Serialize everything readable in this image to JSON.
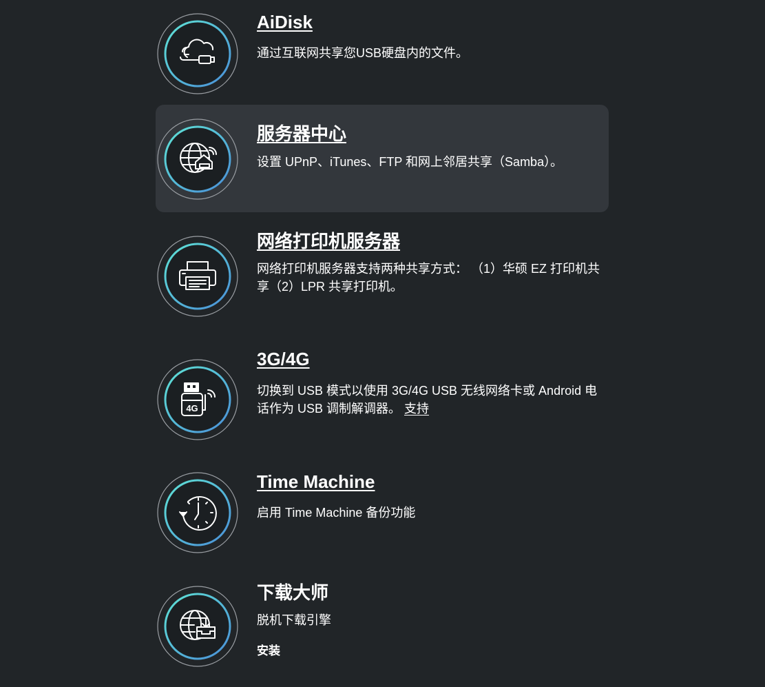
{
  "items": [
    {
      "title": "AiDisk",
      "desc": "通过互联网共享您USB硬盘内的文件。",
      "icon": "cloud-usb-icon"
    },
    {
      "title": "服务器中心",
      "desc": "设置 UPnP、iTunes、FTP 和网上邻居共享（Samba）。",
      "icon": "globe-home-server-icon"
    },
    {
      "title": "网络打印机服务器",
      "desc": "网络打印机服务器支持两种共享方式： （1）华硕 EZ 打印机共享（2）LPR 共享打印机。",
      "icon": "printer-icon"
    },
    {
      "title": "3G/4G",
      "desc": "切换到 USB 模式以使用 3G/4G USB 无线网络卡或 Android 电话作为 USB 调制解调器。",
      "link": "支持",
      "icon": "usb-4g-modem-icon",
      "badge": "4G"
    },
    {
      "title": "Time Machine",
      "desc": "启用 Time Machine 备份功能",
      "icon": "clock-backup-icon"
    },
    {
      "title": "下载大师",
      "desc": "脱机下载引擎",
      "install": "安装",
      "icon": "globe-download-icon"
    }
  ],
  "colors": {
    "background": "#212528",
    "hover": "#33373c",
    "ring_gradient_start": "#5fe3d6",
    "ring_gradient_end": "#4a8fd8"
  }
}
